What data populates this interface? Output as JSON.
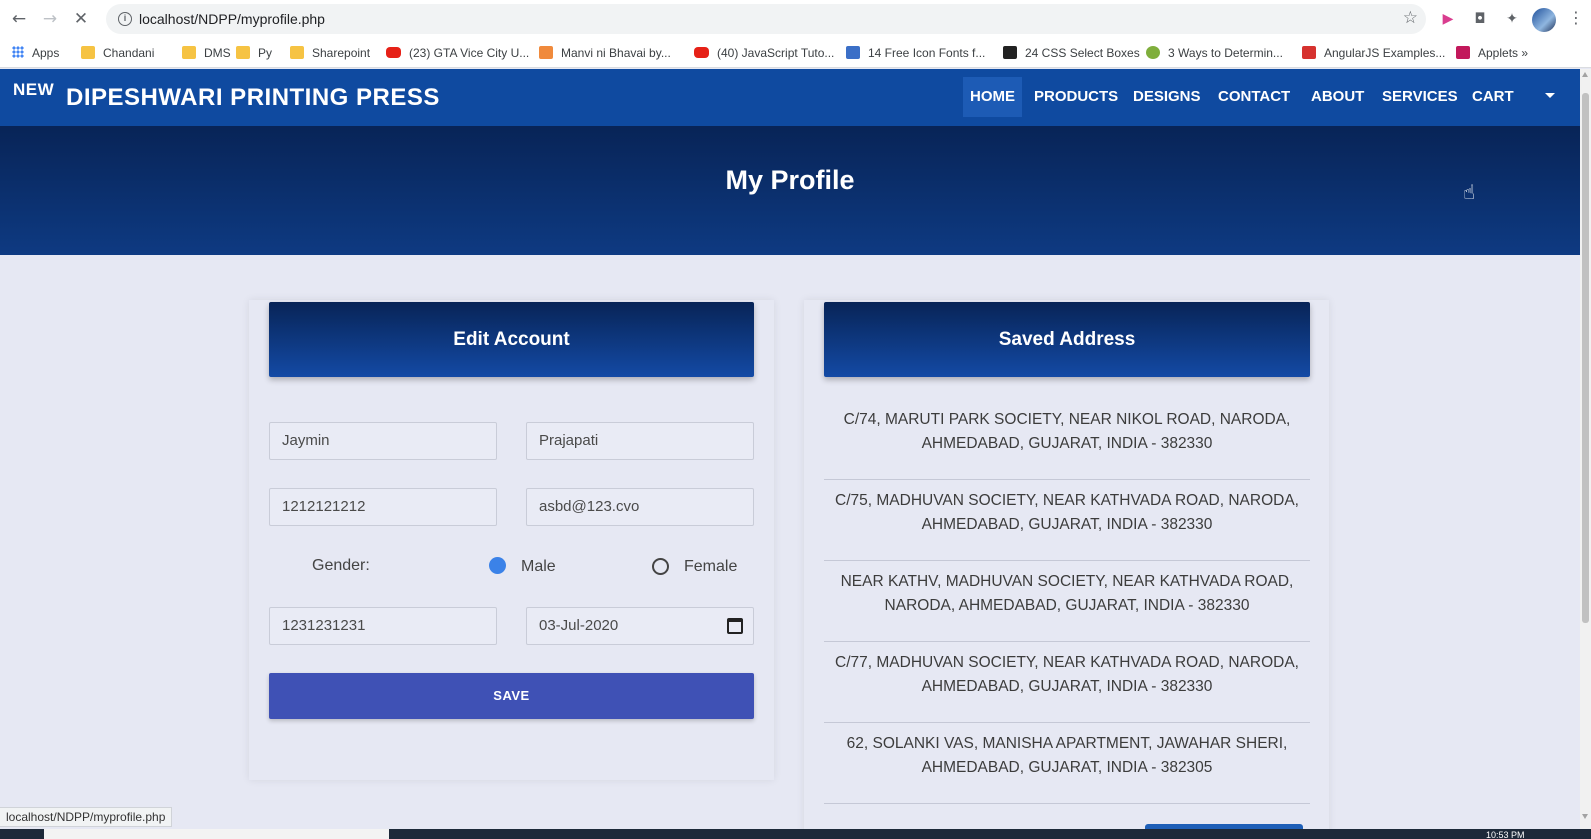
{
  "browser": {
    "url": "localhost/NDPP/myprofile.php",
    "status_text": "localhost/NDPP/myprofile.php",
    "bookmarks": [
      {
        "label": "Apps",
        "icon": "apps-grid-icon"
      },
      {
        "label": "Chandani",
        "icon": "folder-icon"
      },
      {
        "label": "DMS",
        "icon": "folder-icon"
      },
      {
        "label": "Py",
        "icon": "folder-icon"
      },
      {
        "label": "Sharepoint",
        "icon": "folder-icon"
      },
      {
        "label": "(23) GTA Vice City U...",
        "icon": "youtube-icon"
      },
      {
        "label": "Manvi ni Bhavai by...",
        "icon": "site-icon"
      },
      {
        "label": "(40) JavaScript Tuto...",
        "icon": "youtube-icon"
      },
      {
        "label": "14 Free Icon Fonts f...",
        "icon": "fx-icon"
      },
      {
        "label": "24 CSS Select Boxes",
        "icon": "f-icon"
      },
      {
        "label": "3 Ways to Determin...",
        "icon": "site-icon"
      },
      {
        "label": "AngularJS Examples...",
        "icon": "site-icon"
      },
      {
        "label": "Applets",
        "icon": "site-icon"
      }
    ],
    "more_bookmarks": "»",
    "clock": "10:53 PM"
  },
  "site": {
    "brand_prefix": "NEW",
    "brand_name": "DIPESHWARI PRINTING PRESS",
    "nav": [
      "HOME",
      "PRODUCTS",
      "DESIGNS",
      "CONTACT",
      "ABOUT",
      "SERVICES",
      "CART"
    ],
    "active_nav": "HOME",
    "page_title": "My Profile"
  },
  "edit_account": {
    "title": "Edit Account",
    "first_name": "Jaymin",
    "last_name": "Prajapati",
    "phone": "1212121212",
    "email": "asbd@123.cvo",
    "gender_label": "Gender:",
    "gender_options": [
      "Male",
      "Female"
    ],
    "gender_selected": "Male",
    "alt_phone": "1231231231",
    "dob": "03-Jul-2020",
    "save_label": "SAVE"
  },
  "saved_address": {
    "title": "Saved Address",
    "addresses": [
      "C/74, MARUTI PARK SOCIETY, NEAR NIKOL ROAD, NARODA, AHMEDABAD, GUJARAT, INDIA - 382330",
      "C/75, MADHUVAN SOCIETY, NEAR KATHVADA ROAD, NARODA, AHMEDABAD, GUJARAT, INDIA - 382330",
      "NEAR KATHV, MADHUVAN SOCIETY, NEAR KATHVADA ROAD, NARODA, AHMEDABAD, GUJARAT, INDIA - 382330",
      "C/77, MADHUVAN SOCIETY, NEAR KATHVADA ROAD, NARODA, AHMEDABAD, GUJARAT, INDIA - 382330",
      "62, SOLANKI VAS, MANISHA APARTMENT, JAWAHAR SHERI, AHMEDABAD, GUJARAT, INDIA - 382305"
    ]
  },
  "colors": {
    "nav_bg": "#0f4aa0",
    "hero_bg": "#082457",
    "save_button": "#3f51b5",
    "page_bg": "#e6e8f3"
  }
}
